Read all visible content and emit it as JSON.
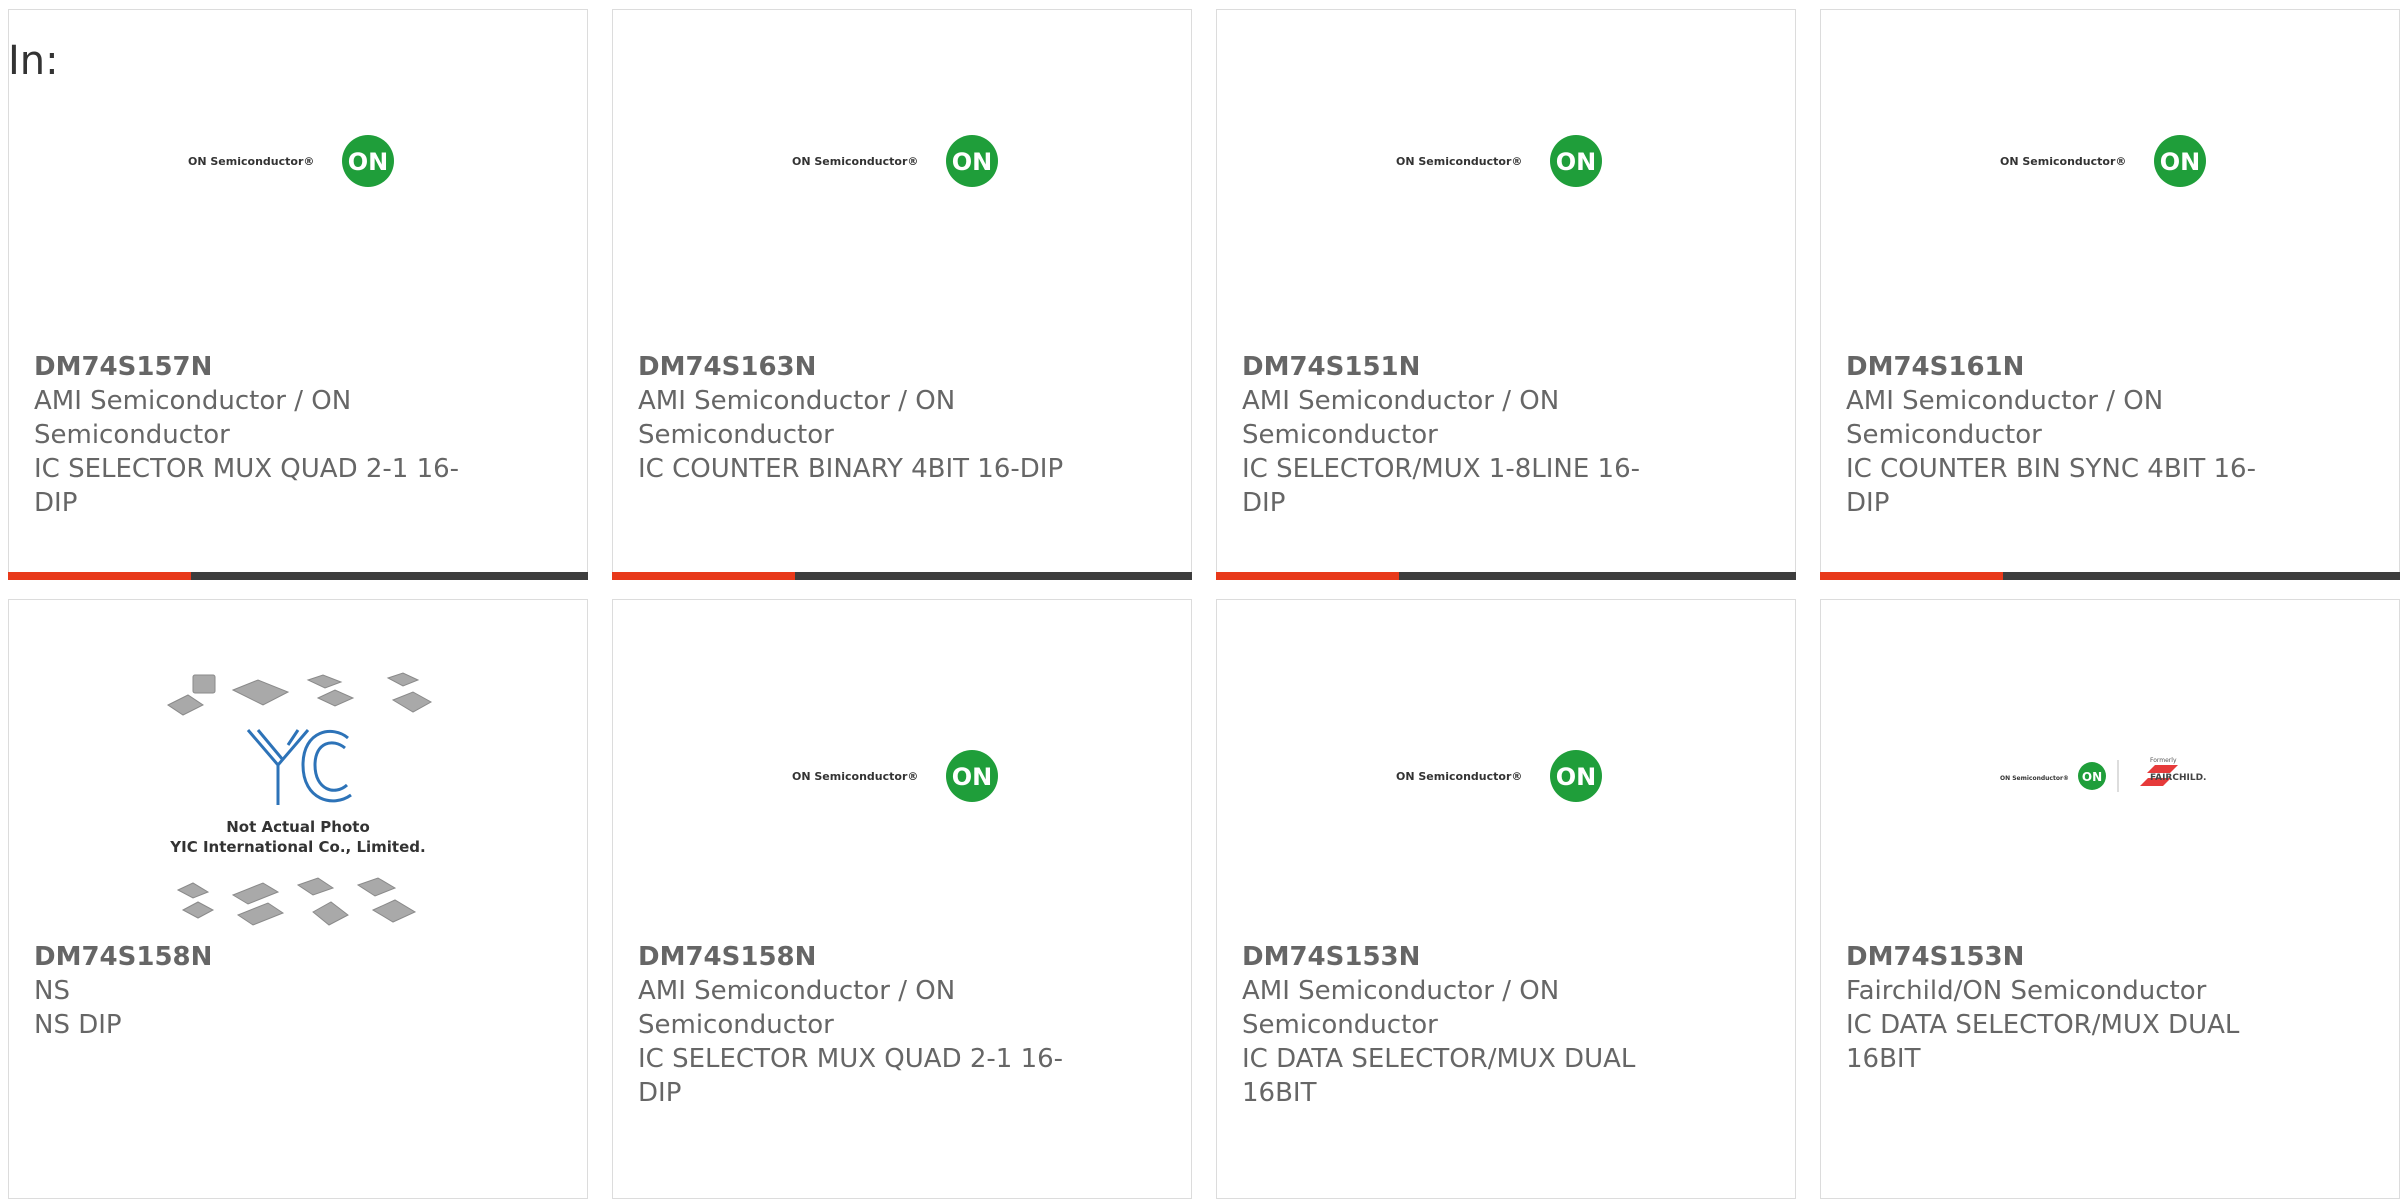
{
  "heading": "In:",
  "colors": {
    "accent": "#e8391a",
    "bar": "#3d3d3d",
    "on_green": "#1f9e3a",
    "text": "#666666"
  },
  "products": [
    {
      "part": "DM74S157N",
      "manufacturer": "AMI Semiconductor / ON Semiconductor",
      "description": "IC SELECTOR MUX QUAD 2-1 16-DIP",
      "logo": "on-semiconductor-logo"
    },
    {
      "part": "DM74S163N",
      "manufacturer": "AMI Semiconductor / ON Semiconductor",
      "description": "IC COUNTER BINARY 4BIT 16-DIP",
      "logo": "on-semiconductor-logo"
    },
    {
      "part": "DM74S151N",
      "manufacturer": "AMI Semiconductor / ON Semiconductor",
      "description": "IC SELECTOR/MUX 1-8LINE 16-DIP",
      "logo": "on-semiconductor-logo"
    },
    {
      "part": "DM74S161N",
      "manufacturer": "AMI Semiconductor / ON Semiconductor",
      "description": "IC COUNTER BIN SYNC 4BIT 16-DIP",
      "logo": "on-semiconductor-logo"
    },
    {
      "part": "DM74S158N",
      "manufacturer": "NS",
      "description": "NS DIP",
      "logo": "yic-placeholder-photo",
      "photo_text": {
        "line1": "Not Actual Photo",
        "line2": "YIC International Co., Limited."
      }
    },
    {
      "part": "DM74S158N",
      "manufacturer": "AMI Semiconductor / ON Semiconductor",
      "description": "IC SELECTOR MUX QUAD 2-1 16-DIP",
      "logo": "on-semiconductor-logo"
    },
    {
      "part": "DM74S153N",
      "manufacturer": "AMI Semiconductor / ON Semiconductor",
      "description": "IC DATA SELECTOR/MUX DUAL 16BIT",
      "logo": "on-semiconductor-logo"
    },
    {
      "part": "DM74S153N",
      "manufacturer": "Fairchild/ON Semiconductor",
      "description": "IC DATA SELECTOR/MUX DUAL 16BIT",
      "logo": "fairchild-on-logo"
    }
  ],
  "logo_text": {
    "on_semiconductor": "ON Semiconductor®",
    "on_mark": "ON",
    "formerly": "Formerly",
    "fairchild": "FAIRCHILD."
  }
}
